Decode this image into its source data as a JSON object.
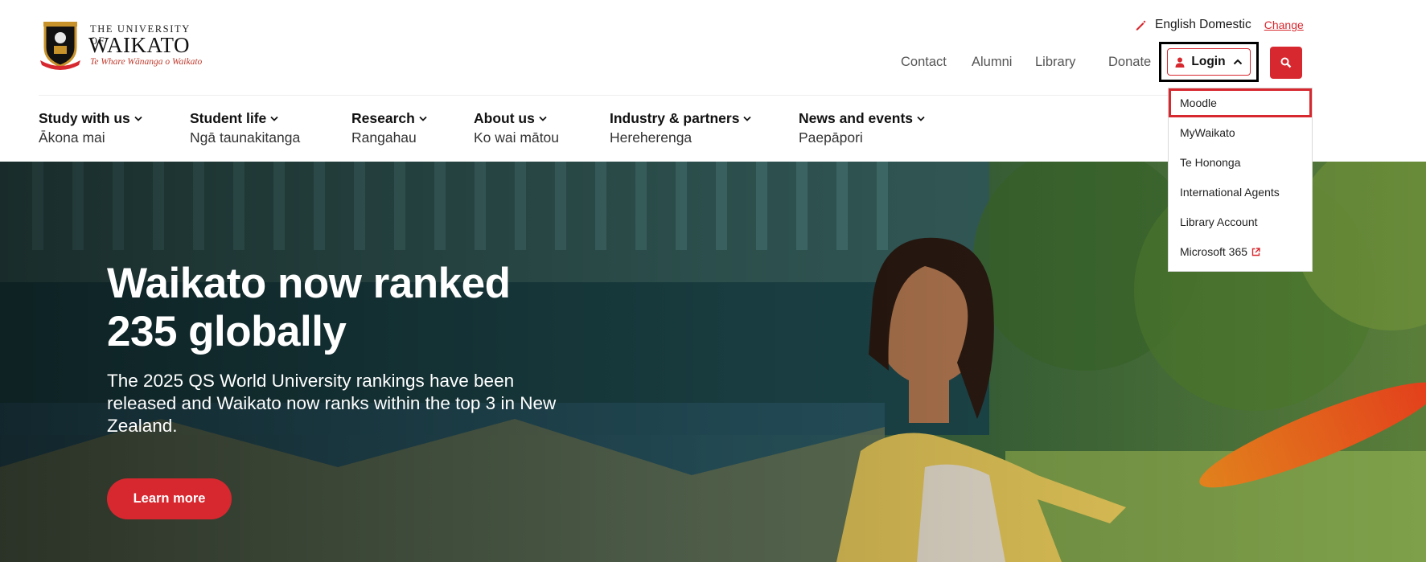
{
  "logo": {
    "line1": "THE UNIVERSITY OF",
    "line2": "WAIKATO",
    "line3": "Te Whare Wānanga o Waikato"
  },
  "lang": {
    "label": "English Domestic",
    "change": "Change"
  },
  "util_links": [
    "Contact",
    "Alumni",
    "Library",
    "Donate"
  ],
  "login": {
    "label": "Login"
  },
  "dropdown": {
    "items": [
      "Moodle",
      "MyWaikato",
      "Te Hononga",
      "International Agents",
      "Library Account",
      "Microsoft 365"
    ],
    "highlighted": "Moodle"
  },
  "nav": [
    {
      "en": "Study with us",
      "mi": "Ākona mai"
    },
    {
      "en": "Student life",
      "mi": "Ngā taunakitanga"
    },
    {
      "en": "Research",
      "mi": "Rangahau"
    },
    {
      "en": "About us",
      "mi": "Ko wai mātou"
    },
    {
      "en": "Industry & partners",
      "mi": "Hereherenga"
    },
    {
      "en": "News and events",
      "mi": "Paepāpori"
    }
  ],
  "hero": {
    "title": "Waikato now ranked 235 globally",
    "text": "The 2025 QS World University rankings have been released and Waikato now ranks within the top 3 in New Zealand.",
    "button": "Learn more"
  },
  "colors": {
    "brand_red": "#d7282f",
    "focus_outline": "#000000",
    "text": "#1a1a1a"
  },
  "icons": [
    "pen-icon",
    "person-icon",
    "chevron-up-icon",
    "search-icon",
    "chevron-down-icon",
    "external-link-icon",
    "crest-icon"
  ]
}
